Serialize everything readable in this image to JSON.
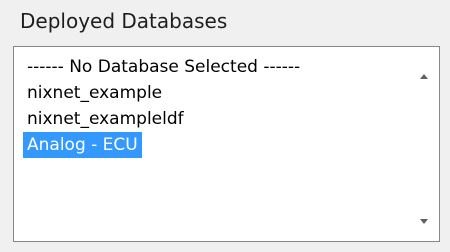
{
  "group": {
    "title": "Deployed Databases"
  },
  "listbox": {
    "items": [
      {
        "label": "------ No Database Selected ------",
        "selected": false
      },
      {
        "label": "nixnet_example",
        "selected": false
      },
      {
        "label": "nixnet_exampleldf",
        "selected": false
      },
      {
        "label": "Analog - ECU",
        "selected": true
      }
    ],
    "selected_index": 3
  },
  "scrollbar": {
    "up_icon": "scroll-up-arrow",
    "down_icon": "scroll-down-arrow"
  },
  "colors": {
    "selection_background": "#3399ff",
    "selection_text": "#ffffff",
    "border": "#828790",
    "window_background": "#f0f0f0"
  }
}
